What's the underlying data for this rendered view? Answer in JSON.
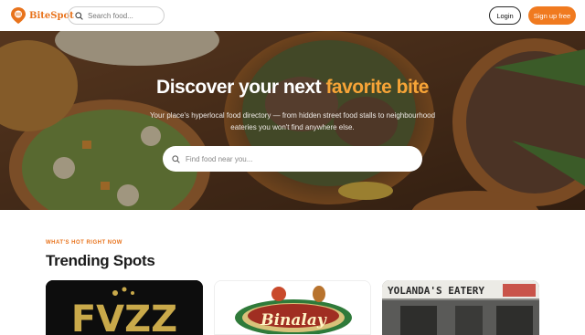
{
  "header": {
    "brand": "BiteSpot",
    "search_placeholder": "Search food...",
    "login_label": "Login",
    "signup_label": "Sign up free",
    "accent_color": "#f07a1f"
  },
  "hero": {
    "title_prefix": "Discover your next ",
    "title_accent": "favorite bite",
    "subtitle": "Your place's hyperlocal food directory — from hidden street food stalls to neighbourhood eateries you won't find anywhere else.",
    "search_placeholder": "Find food near you..."
  },
  "trending": {
    "eyebrow": "WHAT'S HOT RIGHT NOW",
    "title": "Trending Spots",
    "cards": [
      {
        "logo_text": "FVZZ"
      },
      {
        "logo_text": "Binalay"
      },
      {
        "sign_text": "YOLANDA'S EATERY"
      }
    ]
  }
}
